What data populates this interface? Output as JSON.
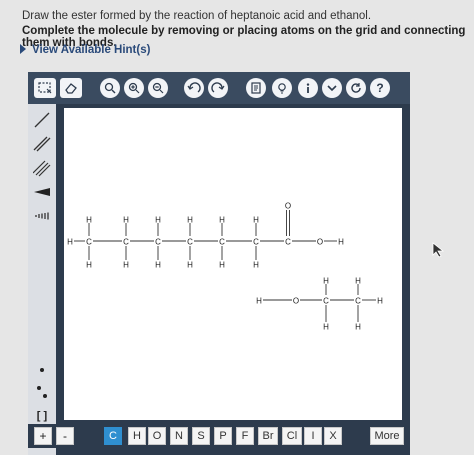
{
  "question": {
    "line1": "Draw the ester formed by the reaction of heptanoic acid and ethanol.",
    "line2": "Complete the molecule by removing or placing atoms on the grid and connecting them with bonds."
  },
  "hint": {
    "label": "View Available Hint(s)"
  },
  "toolbar": {
    "help_label": "?"
  },
  "sidebar": {
    "brackets_label": "[ ]"
  },
  "bottombar": {
    "plus_label": "+",
    "minus_label": "-",
    "elements": [
      "C",
      "H",
      "O",
      "N",
      "S",
      "P",
      "F",
      "Br",
      "Cl",
      "I",
      "X"
    ],
    "active_element": "C",
    "more_label": "More"
  },
  "molecule": {
    "atom_h": "H",
    "atom_c": "C",
    "atom_o": "O"
  },
  "colors": {
    "editor_bg": "#2d3b4d",
    "toolbar_bg": "#3a4b60",
    "active": "#2f8fd0"
  }
}
